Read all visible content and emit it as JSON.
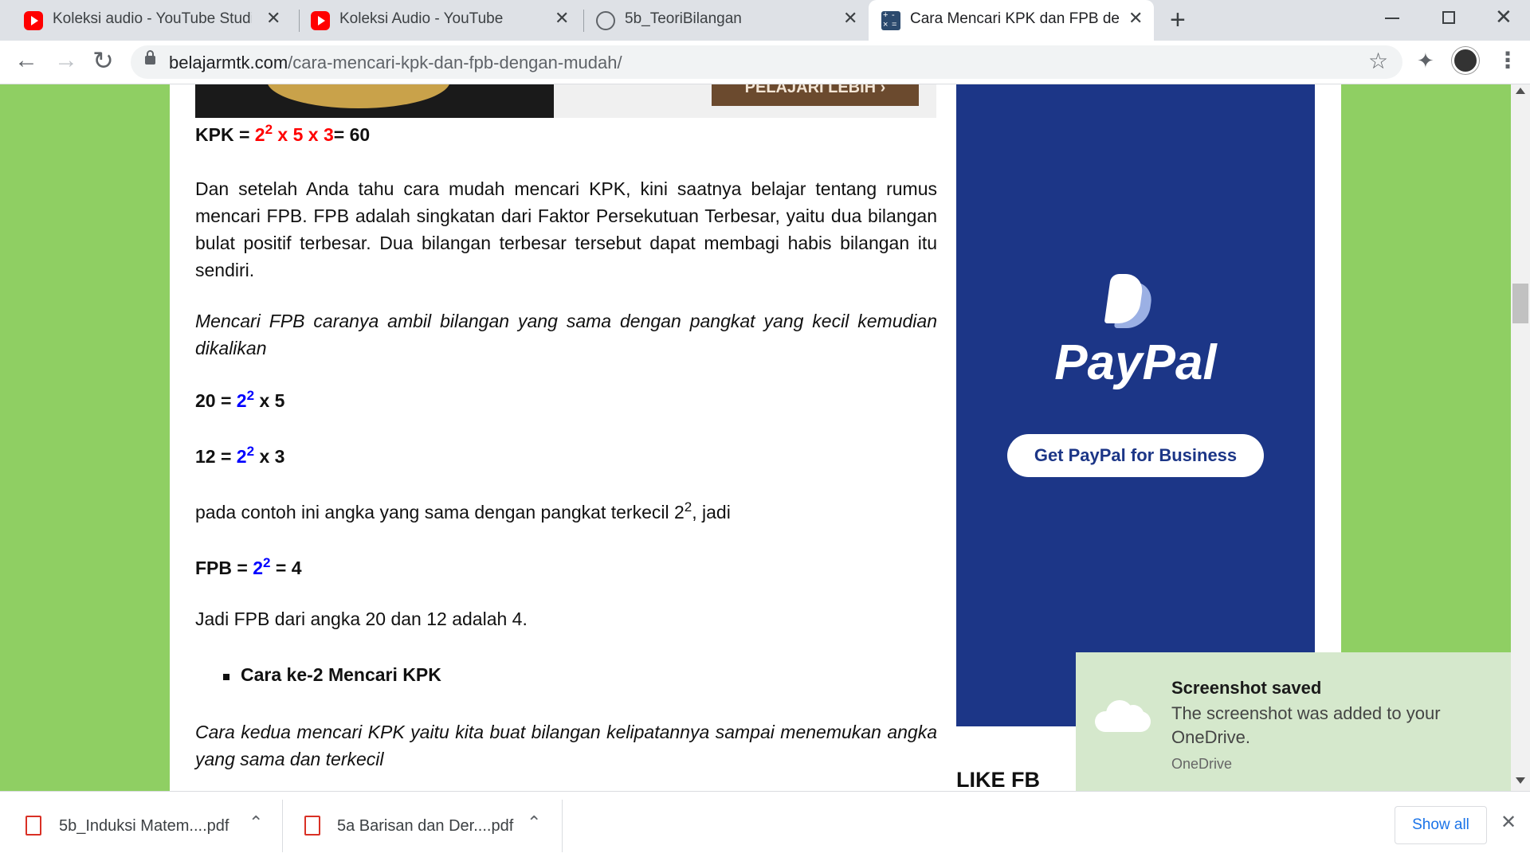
{
  "tabs": [
    {
      "title": "Koleksi audio - YouTube Studio",
      "icon": "youtube-icon"
    },
    {
      "title": "Koleksi Audio - YouTube",
      "icon": "youtube-icon"
    },
    {
      "title": "5b_TeoriBilangan",
      "icon": "globe-icon"
    },
    {
      "title": "Cara Mencari KPK dan FPB denga",
      "icon": "calculator-icon"
    }
  ],
  "address": {
    "domain": "belajarmtk.com",
    "path": "/cara-mencari-kpk-dan-fpb-dengan-mudah/"
  },
  "top_ad_button": "PELAJARI LEBIH",
  "kpk_formula": {
    "label": "KPK = ",
    "base": "2",
    "exp": "2",
    "rest": " x 5 x 3",
    "result": "= 60"
  },
  "para1": "Dan setelah Anda tahu cara mudah mencari KPK, kini saatnya belajar tentang rumus mencari FPB. FPB adalah singkatan dari Faktor Persekutuan Terbesar, yaitu dua bilangan bulat positif terbesar. Dua bilangan terbesar tersebut dapat membagi habis bilangan itu sendiri.",
  "para2": "Mencari FPB caranya ambil bilangan yang sama dengan pangkat yang kecil kemudian dikalikan",
  "eq20": {
    "label": "20 = ",
    "base": "2",
    "exp": "2",
    "rest": " x 5"
  },
  "eq12": {
    "label": "12 = ",
    "base": "2",
    "exp": "2",
    "rest": " x 3"
  },
  "para3": {
    "text": "pada contoh ini angka yang sama dengan pangkat terkecil 2",
    "exp": "2",
    "tail": ", jadi"
  },
  "fpb_formula": {
    "label": "FPB = ",
    "base": "2",
    "exp": "2",
    "rest": " = 4"
  },
  "para4": "Jadi FPB dari angka 20 dan 12 adalah 4.",
  "bullet1": "Cara ke-2 Mencari KPK",
  "para5": "Cara kedua mencari KPK yaitu kita buat bilangan kelipatannya sampai menemukan angka yang sama dan terkecil",
  "paypal": {
    "wordmark": "PayPal",
    "button": "Get PayPal for Business"
  },
  "sidebar_heading": "LIKE FB",
  "toast": {
    "title": "Screenshot saved",
    "body": "The screenshot was added to your OneDrive.",
    "source": "OneDrive"
  },
  "downloads": [
    {
      "name": "5b_Induksi Matem....pdf"
    },
    {
      "name": "5a Barisan dan Der....pdf"
    }
  ],
  "show_all": "Show all",
  "colors": {
    "page_bg": "#8fcf63",
    "ad_blue": "#1c3687",
    "accent_red": "#ff0000",
    "accent_blue": "#0000ff"
  }
}
